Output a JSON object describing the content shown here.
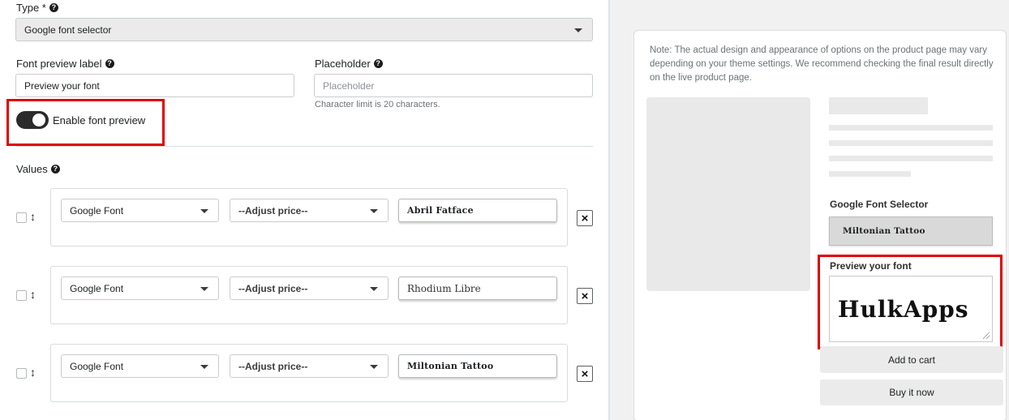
{
  "form": {
    "type_label": "Type *",
    "type_value": "Google font selector",
    "font_preview_label": "Font preview label",
    "font_preview_value": "Preview your font",
    "placeholder_label": "Placeholder",
    "placeholder_placeholder": "Placeholder",
    "char_limit": "Character limit is 20 characters.",
    "enable_preview": "Enable font preview",
    "enable_preview_on": true,
    "values_label": "Values"
  },
  "rows": [
    {
      "type": "Google Font",
      "price": "--Adjust price--",
      "font": "Abril Fatface"
    },
    {
      "type": "Google Font",
      "price": "--Adjust price--",
      "font": "Rhodium Libre"
    },
    {
      "type": "Google Font",
      "price": "--Adjust price--",
      "font": "Miltonian Tattoo"
    }
  ],
  "preview": {
    "note": "Note: The actual design and appearance of options on the product page may vary depending on your theme settings. We recommend checking the final result directly on the live product page.",
    "selector_title": "Google Font Selector",
    "selector_value": "Miltonian Tattoo",
    "preview_title": "Preview your font",
    "preview_text": "HulkApps",
    "add_to_cart": "Add to cart",
    "buy_now": "Buy it now"
  },
  "colors": {
    "highlight": "#e00000",
    "toggle_on": "#2b2b2b",
    "panel_bg": "#f1f1f1"
  }
}
